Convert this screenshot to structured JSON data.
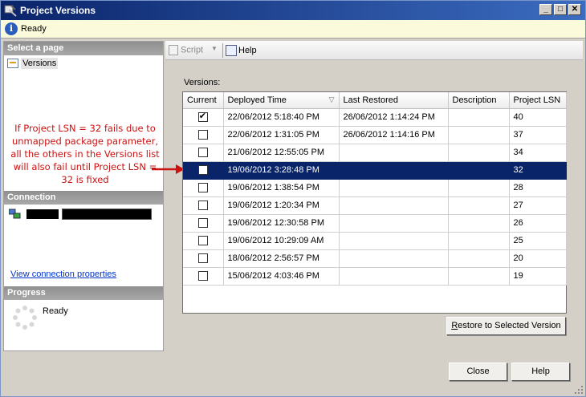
{
  "window": {
    "title": "Project Versions"
  },
  "status": {
    "text": "Ready"
  },
  "left": {
    "select_page_header": "Select a page",
    "page_item": "Versions",
    "annotation": "If Project LSN = 32 fails due to unmapped package parameter, all the others in the Versions list will also fail until Project LSN = 32 is fixed",
    "connection_header": "Connection",
    "connection_link": "View connection properties",
    "progress_header": "Progress",
    "progress_text": "Ready"
  },
  "toolbar": {
    "script_label": "Script",
    "help_label": "Help"
  },
  "versions": {
    "label": "Versions:",
    "columns": [
      "Current",
      "Deployed Time",
      "Last Restored",
      "Description",
      "Project LSN"
    ],
    "rows": [
      {
        "current": true,
        "deployed": "22/06/2012 5:18:40 PM",
        "restored": "26/06/2012 1:14:24 PM",
        "description": "",
        "lsn": "40",
        "selected": false
      },
      {
        "current": false,
        "deployed": "22/06/2012 1:31:05 PM",
        "restored": "26/06/2012 1:14:16 PM",
        "description": "",
        "lsn": "37",
        "selected": false
      },
      {
        "current": false,
        "deployed": "21/06/2012 12:55:05 PM",
        "restored": "",
        "description": "",
        "lsn": "34",
        "selected": false
      },
      {
        "current": false,
        "deployed": "19/06/2012 3:28:48 PM",
        "restored": "",
        "description": "",
        "lsn": "32",
        "selected": true
      },
      {
        "current": false,
        "deployed": "19/06/2012 1:38:54 PM",
        "restored": "",
        "description": "",
        "lsn": "28",
        "selected": false
      },
      {
        "current": false,
        "deployed": "19/06/2012 1:20:34 PM",
        "restored": "",
        "description": "",
        "lsn": "27",
        "selected": false
      },
      {
        "current": false,
        "deployed": "19/06/2012 12:30:58 PM",
        "restored": "",
        "description": "",
        "lsn": "26",
        "selected": false
      },
      {
        "current": false,
        "deployed": "19/06/2012 10:29:09 AM",
        "restored": "",
        "description": "",
        "lsn": "25",
        "selected": false
      },
      {
        "current": false,
        "deployed": "18/06/2012 2:56:57 PM",
        "restored": "",
        "description": "",
        "lsn": "20",
        "selected": false
      },
      {
        "current": false,
        "deployed": "15/06/2012 4:03:46 PM",
        "restored": "",
        "description": "",
        "lsn": "19",
        "selected": false
      }
    ]
  },
  "buttons": {
    "restore_prefix": "R",
    "restore_rest": "estore to Selected Version",
    "close": "Close",
    "help": "Help"
  },
  "colors": {
    "selection": "#0a246a",
    "annotation": "#cc1111",
    "titlebar": "#0a246a"
  }
}
